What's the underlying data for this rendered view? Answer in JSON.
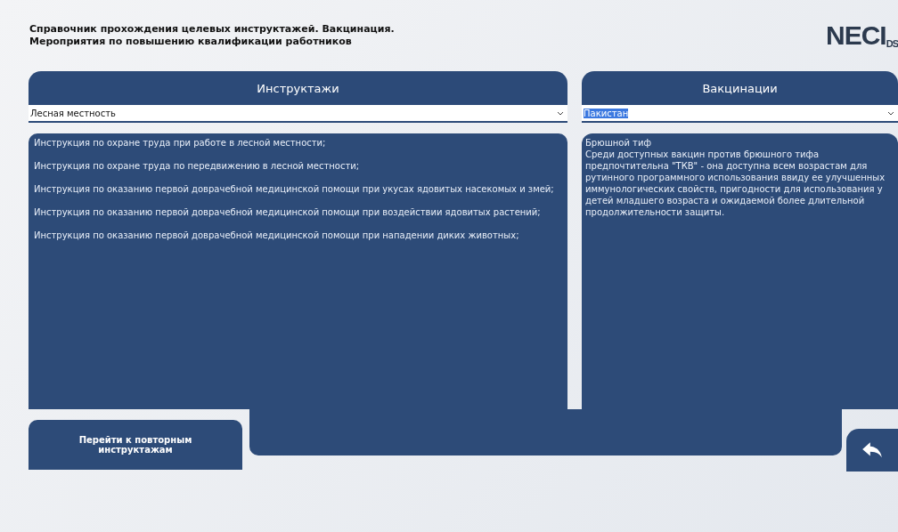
{
  "header": {
    "title_lines": [
      "Справочник прохождения целевых инструктажей. Вакцинация.",
      "Мероприятия по повышению квалификации работников"
    ],
    "logo": {
      "main": "NECI",
      "sub": "DS"
    }
  },
  "instructions": {
    "title": "Инструктажи",
    "select": {
      "value": "Лесная местность",
      "highlighted": false
    },
    "items": [
      "Инструкция по охране труда при работе в лесной местности;",
      "Инструкция по охране труда по передвижению в лесной местности;",
      "Инструкция по оказанию первой доврачебной медицинской помощи при укусах ядовитых насекомых и змей;",
      "Инструкция по оказанию первой доврачебной медицинской помощи при воздействии ядовитых растений;",
      "Инструкция по оказанию первой доврачебной медицинской помощи при нападении диких животных;"
    ]
  },
  "vaccinations": {
    "title": "Вакцинации",
    "select": {
      "value": "Пакистан",
      "highlighted": true
    },
    "heading": "Брюшной тиф",
    "text": "Среди доступных вакцин против брюшного тифа предпочтительна  \"ТКВ\" - она доступна всем возрастам для рутинного программного использования ввиду ее улучшенных иммунологических свойств, пригодности для использования у детей младшего возраста и ожидаемой более длительной продолжительности защиты."
  },
  "footer": {
    "button": "Перейти к повторным инструктажам"
  }
}
